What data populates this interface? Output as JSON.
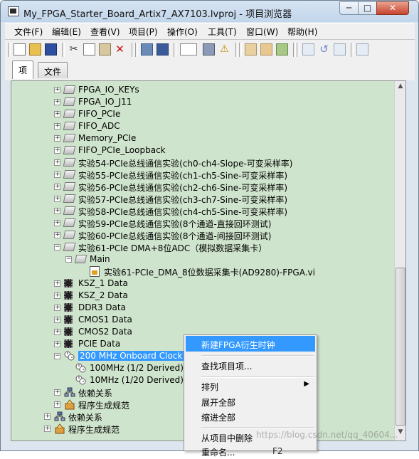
{
  "window": {
    "title": "My_FPGA_Starter_Board_Artix7_AX7103.lvproj - 项目浏览器",
    "minimize": "─",
    "maximize": "□",
    "close": "✕"
  },
  "menu": [
    "文件(F)",
    "编辑(E)",
    "查看(V)",
    "项目(P)",
    "操作(O)",
    "工具(T)",
    "窗口(W)",
    "帮助(H)"
  ],
  "tabs": [
    {
      "label": "项",
      "active": true
    },
    {
      "label": "文件",
      "active": false
    }
  ],
  "tree": [
    {
      "label": "FPGA_IO_KEYs",
      "icon": "folder-icon",
      "indent": 1
    },
    {
      "label": "FPGA_IO_J11",
      "icon": "folder-icon",
      "indent": 1
    },
    {
      "label": "FIFO_PCIe",
      "icon": "folder-icon",
      "indent": 1
    },
    {
      "label": "FIFO_ADC",
      "icon": "folder-icon",
      "indent": 1
    },
    {
      "label": "Memory_PCIe",
      "icon": "folder-icon",
      "indent": 1
    },
    {
      "label": "FIFO_PCIe_Loopback",
      "icon": "folder-icon",
      "indent": 1
    },
    {
      "label": "实验54-PCIe总线通信实验(ch0-ch4-Slope-可变采样率)",
      "icon": "folder-icon",
      "indent": 1
    },
    {
      "label": "实验55-PCIe总线通信实验(ch1-ch5-Sine-可变采样率)",
      "icon": "folder-icon",
      "indent": 1
    },
    {
      "label": "实验56-PCIe总线通信实验(ch2-ch6-Sine-可变采样率)",
      "icon": "folder-icon",
      "indent": 1
    },
    {
      "label": "实验57-PCIe总线通信实验(ch3-ch7-Sine-可变采样率)",
      "icon": "folder-icon",
      "indent": 1
    },
    {
      "label": "实验58-PCIe总线通信实验(ch4-ch5-Sine-可变采样率)",
      "icon": "folder-icon",
      "indent": 1
    },
    {
      "label": "实验59-PCIe总线通信实验(8个通道-直接回环测试)",
      "icon": "folder-icon",
      "indent": 1
    },
    {
      "label": "实验60-PCIe总线通信实验(8个通道-间接回环测试)",
      "icon": "folder-icon",
      "indent": 1
    },
    {
      "label": "实验61-PCIe DMA+8位ADC（模拟数据采集卡）",
      "icon": "folder-icon",
      "indent": 1,
      "expanded": true
    },
    {
      "label": "Main",
      "icon": "folder-icon",
      "indent": 2,
      "expanded": true
    },
    {
      "label": "实验61-PCIe_DMA_8位数据采集卡(AD9280)-FPGA.vi",
      "icon": "vi-icon",
      "indent": 3
    },
    {
      "label": "KSZ_1 Data",
      "icon": "chip-icon",
      "indent": 1
    },
    {
      "label": "KSZ_2 Data",
      "icon": "chip-icon",
      "indent": 1
    },
    {
      "label": "DDR3 Data",
      "icon": "chip-icon",
      "indent": 1
    },
    {
      "label": "CMOS1 Data",
      "icon": "chip-icon",
      "indent": 1
    },
    {
      "label": "CMOS2 Data",
      "icon": "chip-icon",
      "indent": 1
    },
    {
      "label": "PCIE Data",
      "icon": "chip-icon",
      "indent": 1
    },
    {
      "label": "200 MHz Onboard Clock",
      "icon": "clock-icon",
      "indent": 1,
      "selected": true,
      "expanded": true
    },
    {
      "label": "100MHz (1/2 Derived)",
      "icon": "clock-icon",
      "indent": 2
    },
    {
      "label": "10MHz (1/20 Derived)",
      "icon": "clock-icon",
      "indent": 2
    },
    {
      "label": "依赖关系",
      "icon": "dependencies-icon",
      "indent": 1
    },
    {
      "label": "程序生成规范",
      "icon": "build-spec-icon",
      "indent": 1
    },
    {
      "label": "依赖关系",
      "icon": "dependencies-icon",
      "indent": 0
    },
    {
      "label": "程序生成规范",
      "icon": "build-spec-icon",
      "indent": 0
    }
  ],
  "context_menu": [
    {
      "label": "新建FPGA衍生时钟",
      "highlighted": true
    },
    {
      "label": "查找项目项..."
    },
    {
      "label": "排列",
      "submenu": true
    },
    {
      "label": "展开全部"
    },
    {
      "label": "缩进全部"
    },
    {
      "label": "从项目中删除"
    },
    {
      "label": "重命名...",
      "shortcut": "F2"
    }
  ],
  "watermark": "https://blog.csdn.net/qq_40604...",
  "colors": {
    "tree_background": "#cfe4cc",
    "selection": "#3399ff"
  }
}
